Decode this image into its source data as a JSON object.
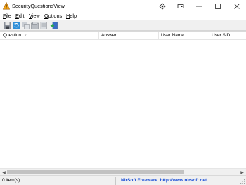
{
  "window": {
    "title": "SecurityQuestionsView",
    "icon": "app-warning-triangle-icon",
    "controls": [
      "pin-icon",
      "restore-snap-icon",
      "minimize-icon",
      "maximize-icon",
      "close-icon"
    ]
  },
  "menu": {
    "items": [
      {
        "label": "File",
        "accel": "F",
        "rest": "ile"
      },
      {
        "label": "Edit",
        "accel": "E",
        "rest": "dit"
      },
      {
        "label": "View",
        "accel": "V",
        "rest": "iew"
      },
      {
        "label": "Options",
        "accel": "O",
        "rest": "ptions"
      },
      {
        "label": "Help",
        "accel": "H",
        "rest": "elp"
      }
    ]
  },
  "toolbar": {
    "buttons": [
      "save-icon",
      "refresh-icon",
      "copy-icon",
      "properties-icon",
      "html-report-icon",
      "exit-icon"
    ]
  },
  "list": {
    "columns": [
      {
        "label": "Question",
        "sort_indicator": "/"
      },
      {
        "label": "Answer"
      },
      {
        "label": "User Name"
      },
      {
        "label": "User SID"
      }
    ],
    "rows": []
  },
  "status": {
    "count": "0 item(s)",
    "credit": "NirSoft Freeware.  http://www.nirsoft.net"
  },
  "colors": {
    "credit_link": "#1a4fd6",
    "toolbar_bg": "#f0f0f0"
  }
}
